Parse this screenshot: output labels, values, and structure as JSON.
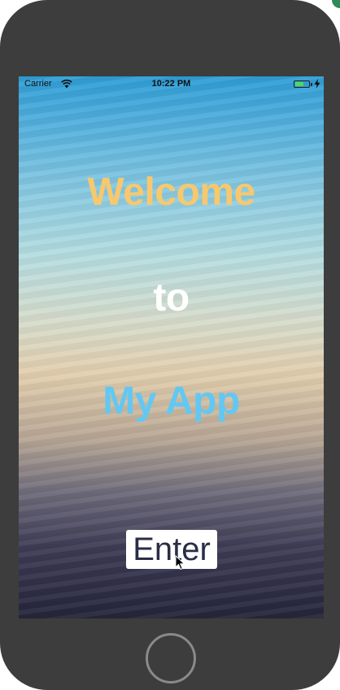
{
  "status_bar": {
    "carrier": "Carrier",
    "time": "10:22 PM",
    "battery_level": 0.6,
    "battery_color": "#4cd964",
    "icons": [
      "wifi-icon",
      "battery-icon",
      "charging-bolt-icon"
    ]
  },
  "screen": {
    "line1": "Welcome",
    "line2": "to",
    "line3": "My App",
    "line1_color": "#f7c86d",
    "line2_color": "#ffffff",
    "line3_color": "#62c8f2"
  },
  "enter_button": {
    "label": "Enter"
  },
  "device": {
    "home_button_icon": "home-button"
  }
}
